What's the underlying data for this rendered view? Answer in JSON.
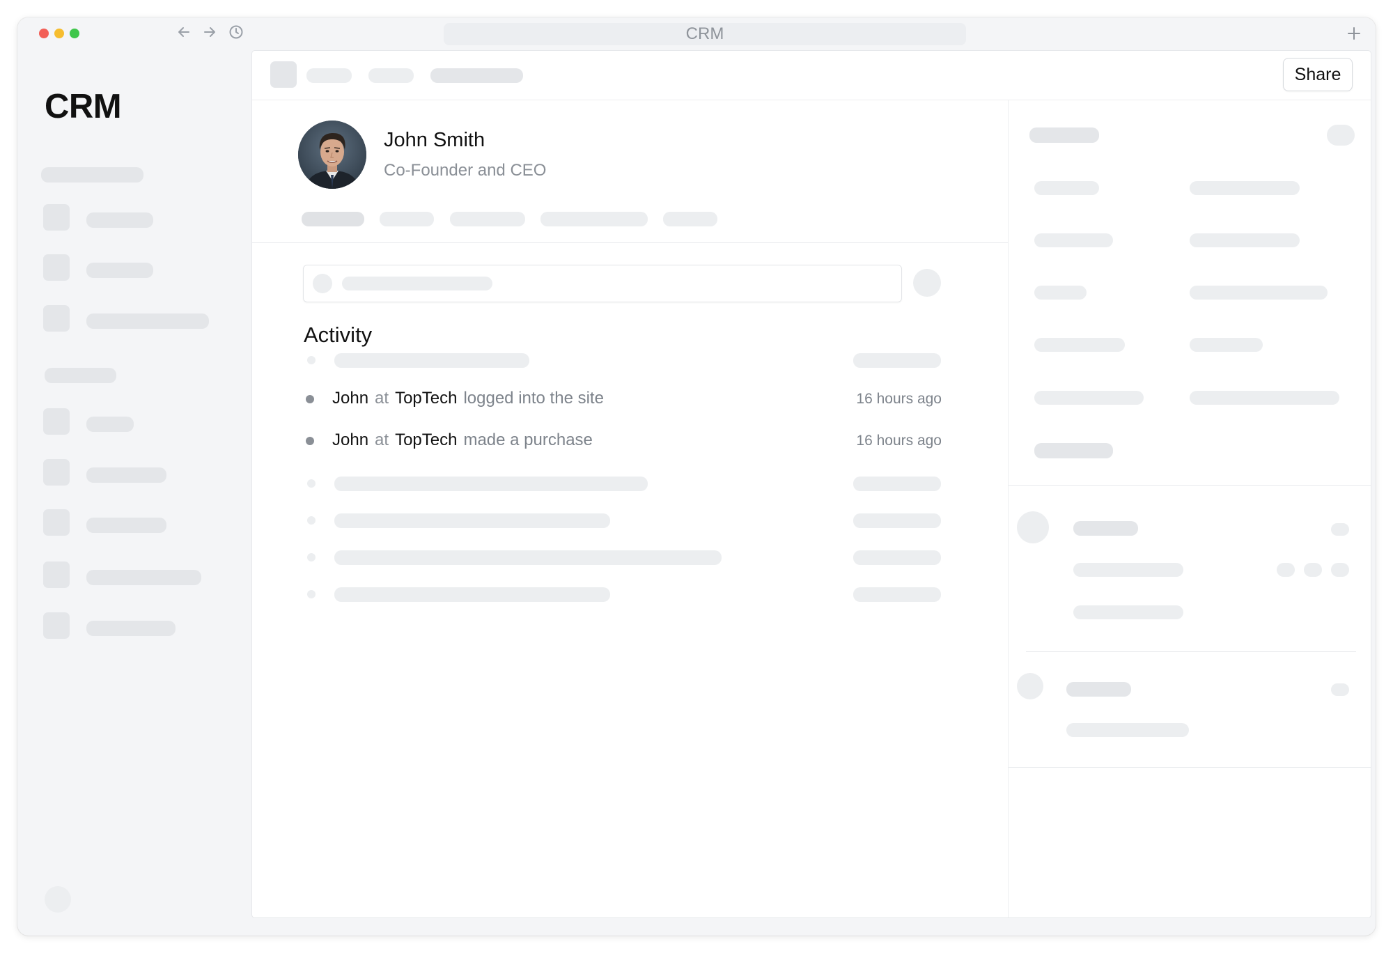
{
  "window": {
    "title": "CRM"
  },
  "colors": {
    "close": "#f25f57",
    "minimize": "#f6bd2f",
    "maximize": "#3fc64b"
  },
  "icons": {
    "back": "arrow-left-icon",
    "forward": "arrow-right-icon",
    "history": "clock-icon",
    "new_tab": "plus-icon"
  },
  "sidebar": {
    "logo": "CRM"
  },
  "toolbar": {
    "share_label": "Share"
  },
  "profile": {
    "name": "John Smith",
    "title": "Co-Founder and CEO"
  },
  "activity": {
    "heading": "Activity",
    "items": [
      {
        "who": "John",
        "connector": "at",
        "org": "TopTech",
        "verb": "logged into the site",
        "time": "16 hours ago"
      },
      {
        "who": "John",
        "connector": "at",
        "org": "TopTech",
        "verb": "made a purchase",
        "time": "16 hours ago"
      }
    ]
  }
}
